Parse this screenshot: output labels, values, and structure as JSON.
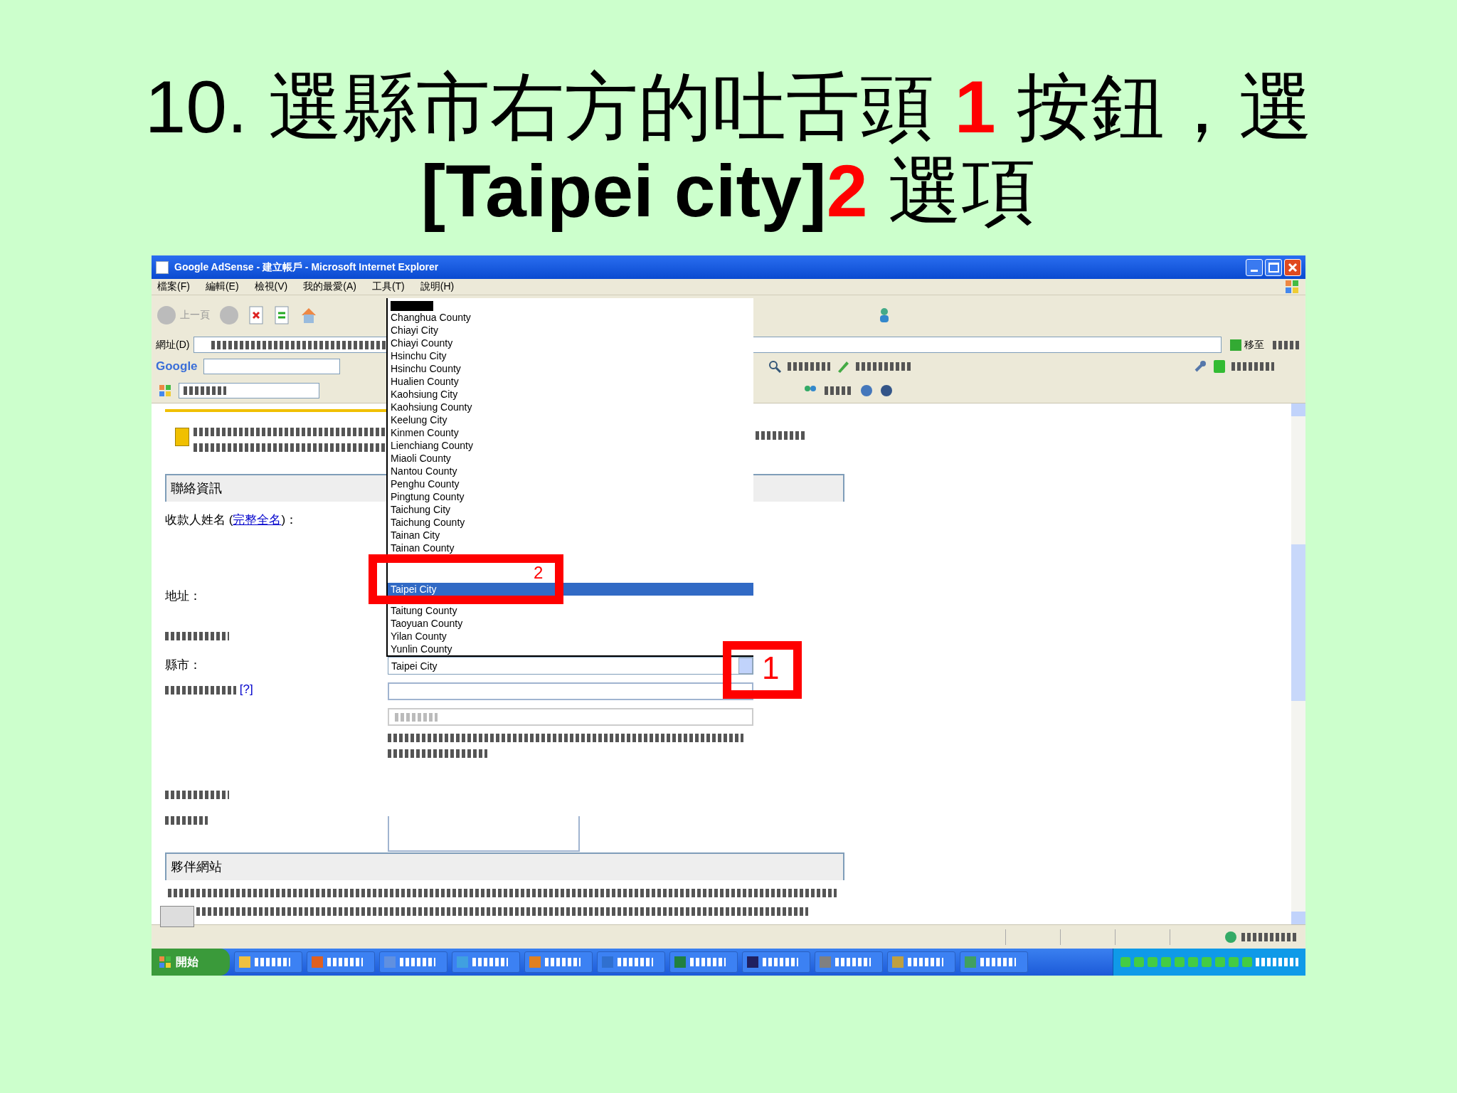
{
  "slide": {
    "title_lines": [
      [
        {
          "kind": "plain",
          "text": "10. 選縣市右方的吐舌頭 "
        },
        {
          "kind": "marker",
          "text": "1"
        },
        {
          "kind": "plain",
          "text": " 按鈕，選"
        }
      ],
      [
        {
          "kind": "bold",
          "text": "[Taipei city]"
        },
        {
          "kind": "marker",
          "text": "2"
        },
        {
          "kind": "plain",
          "text": " 選項"
        }
      ]
    ]
  },
  "window": {
    "title": "Google AdSense - 建立帳戶 - Microsoft Internet Explorer"
  },
  "menu": [
    "檔案(F)",
    "編輯(E)",
    "檢視(V)",
    "我的最愛(A)",
    "工具(T)",
    "說明(H)"
  ],
  "toolbar": {
    "back_label": "上一頁"
  },
  "address_bar": {
    "label": "網址(D)",
    "go_label": "移至"
  },
  "google_toolbar": {
    "logo": "Google"
  },
  "form": {
    "contact_header": "聯絡資訊",
    "payee_label": "收款人姓名 (",
    "payee_link": "完整全名",
    "payee_suffix": ")：",
    "address_label": "地址：",
    "county_label": "縣市：",
    "help_link": "[?]",
    "partner_header": "夥伴網站"
  },
  "county_select": {
    "value": "Taipei City",
    "expanded": true,
    "options": [
      {
        "label": "Changhua County",
        "selected": false
      },
      {
        "label": "Chiayi City",
        "selected": false
      },
      {
        "label": "Chiayi County",
        "selected": false
      },
      {
        "label": "Hsinchu City",
        "selected": false
      },
      {
        "label": "Hsinchu County",
        "selected": false
      },
      {
        "label": "Hualien County",
        "selected": false
      },
      {
        "label": "Kaohsiung City",
        "selected": false
      },
      {
        "label": "Kaohsiung County",
        "selected": false
      },
      {
        "label": "Keelung City",
        "selected": false
      },
      {
        "label": "Kinmen County",
        "selected": false
      },
      {
        "label": "Lienchiang County",
        "selected": false
      },
      {
        "label": "Miaoli County",
        "selected": false
      },
      {
        "label": "Nantou County",
        "selected": false
      },
      {
        "label": "Penghu County",
        "selected": false
      },
      {
        "label": "Pingtung County",
        "selected": false
      },
      {
        "label": "Taichung City",
        "selected": false
      },
      {
        "label": "Taichung County",
        "selected": false
      },
      {
        "label": "Tainan City",
        "selected": false
      },
      {
        "label": "Tainan County",
        "selected": false
      },
      {
        "label": "Taipei City",
        "selected": true
      },
      {
        "label": "Taitung County",
        "selected": false
      },
      {
        "label": "Taoyuan County",
        "selected": false
      },
      {
        "label": "Yilan County",
        "selected": false
      },
      {
        "label": "Yunlin County",
        "selected": false
      }
    ]
  },
  "callouts": [
    {
      "label": "1"
    },
    {
      "label": "2"
    }
  ],
  "taskbar": {
    "start_label": "開始"
  }
}
